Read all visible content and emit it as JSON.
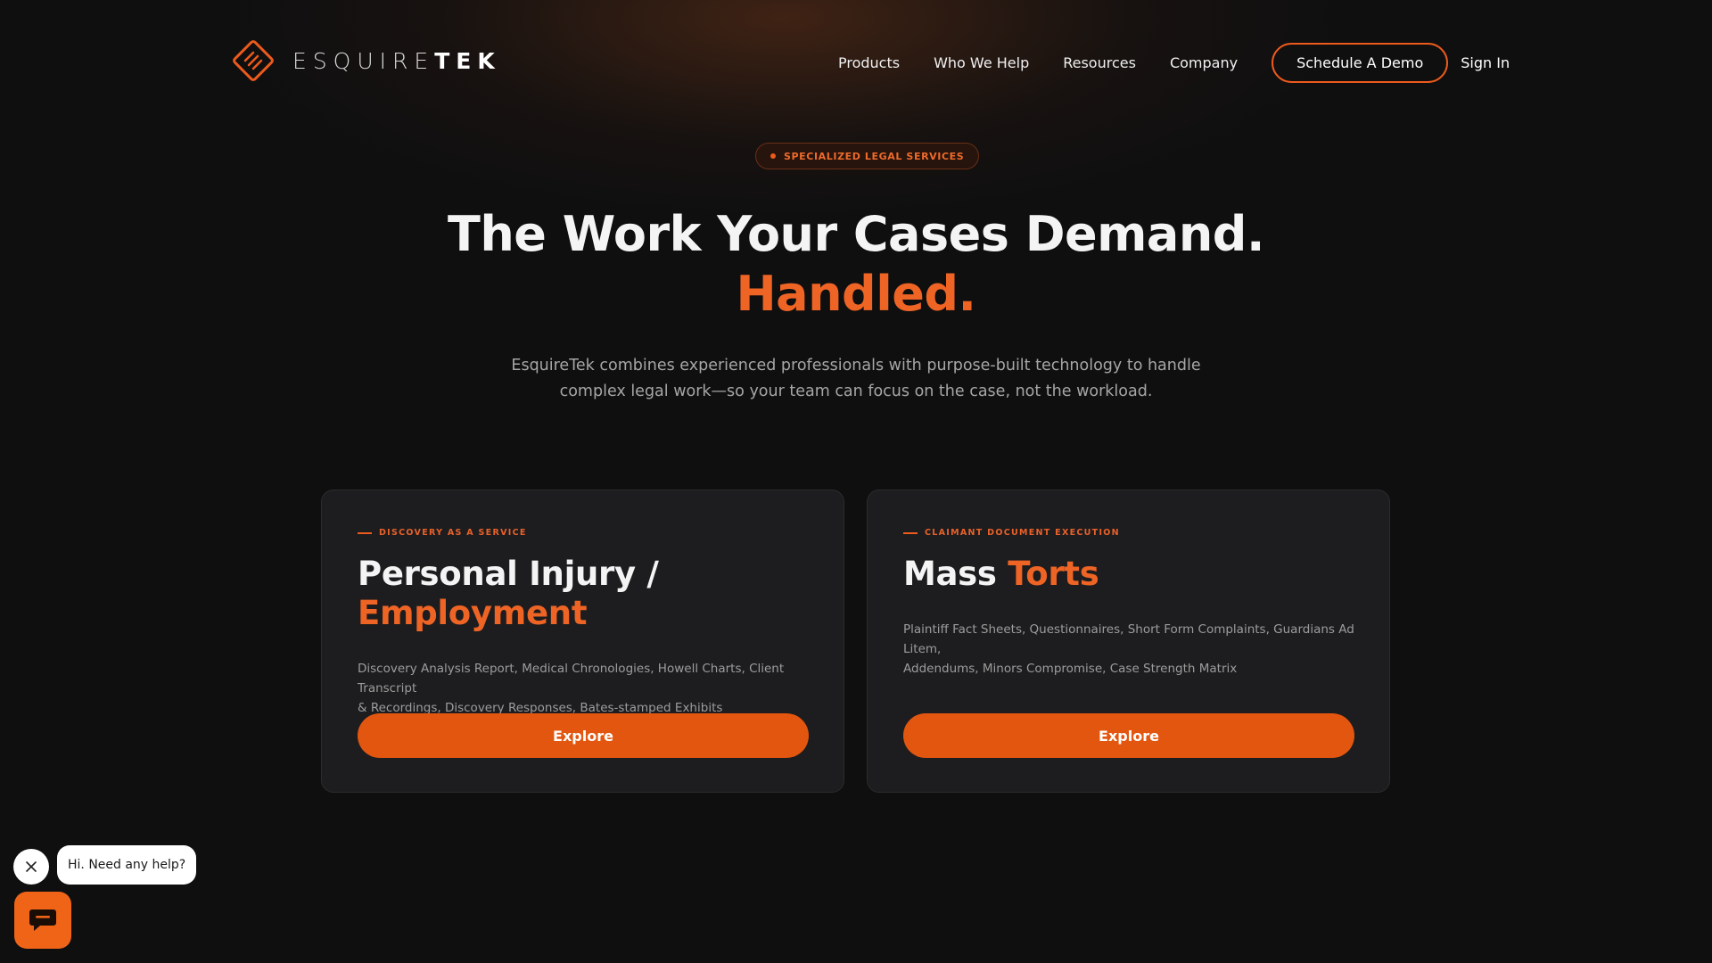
{
  "brand": {
    "name_light": "ESQUIRE",
    "name_bold": "TEK",
    "logo_icon": "esquiretek-diamond-logo",
    "accent_color": "#ee6425"
  },
  "nav": {
    "items": [
      "Products",
      "Who We Help",
      "Resources",
      "Company"
    ],
    "cta_label": "Schedule A Demo",
    "signin_label": "Sign In"
  },
  "hero": {
    "badge": "SPECIALIZED LEGAL SERVICES",
    "title_line1": "The Work Your Cases Demand.",
    "title_line2": "Handled.",
    "subtitle_line1": "EsquireTek combines experienced professionals with purpose-built technology to handle",
    "subtitle_line2": "complex legal work—so your team can focus on the case, not the workload."
  },
  "cards": [
    {
      "eyebrow": "DISCOVERY AS A SERVICE",
      "title_plain": "Personal Injury /",
      "title_accent": "Employment",
      "description_line1": "Discovery Analysis Report, Medical Chronologies, Howell Charts, Client Transcript",
      "description_line2": "& Recordings, Discovery Responses, Bates-stamped Exhibits",
      "button_label": "Explore"
    },
    {
      "eyebrow": "CLAIMANT DOCUMENT EXECUTION",
      "title_plain": "Mass ",
      "title_accent": "Torts",
      "description_line1": "Plaintiff Fact Sheets, Questionnaires, Short Form Complaints, Guardians Ad Litem,",
      "description_line2": "Addendums, Minors Compromise, Case Strength Matrix",
      "button_label": "Explore"
    }
  ],
  "chat": {
    "message": "Hi. Need any help?",
    "close_icon": "close-icon",
    "launcher_icon": "chat-icon"
  }
}
